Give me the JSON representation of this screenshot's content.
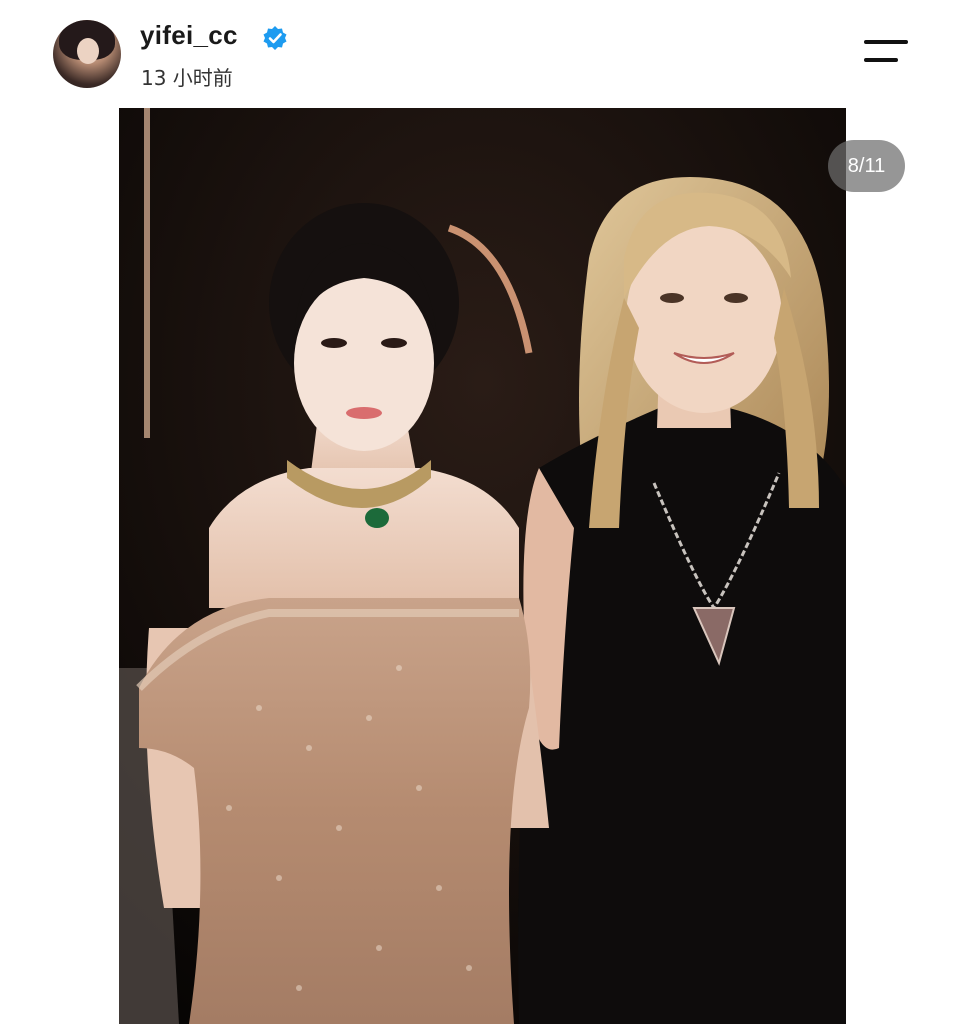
{
  "post": {
    "username": "yifei_cc",
    "time": "13 小时前",
    "verified": true,
    "avatar_icon": "profile-avatar",
    "menu_icon": "hamburger-menu-icon"
  },
  "carousel": {
    "counter": "8/11"
  },
  "colors": {
    "verified_badge": "#1d9bf0",
    "counter_bg": "#6e6e6e"
  }
}
